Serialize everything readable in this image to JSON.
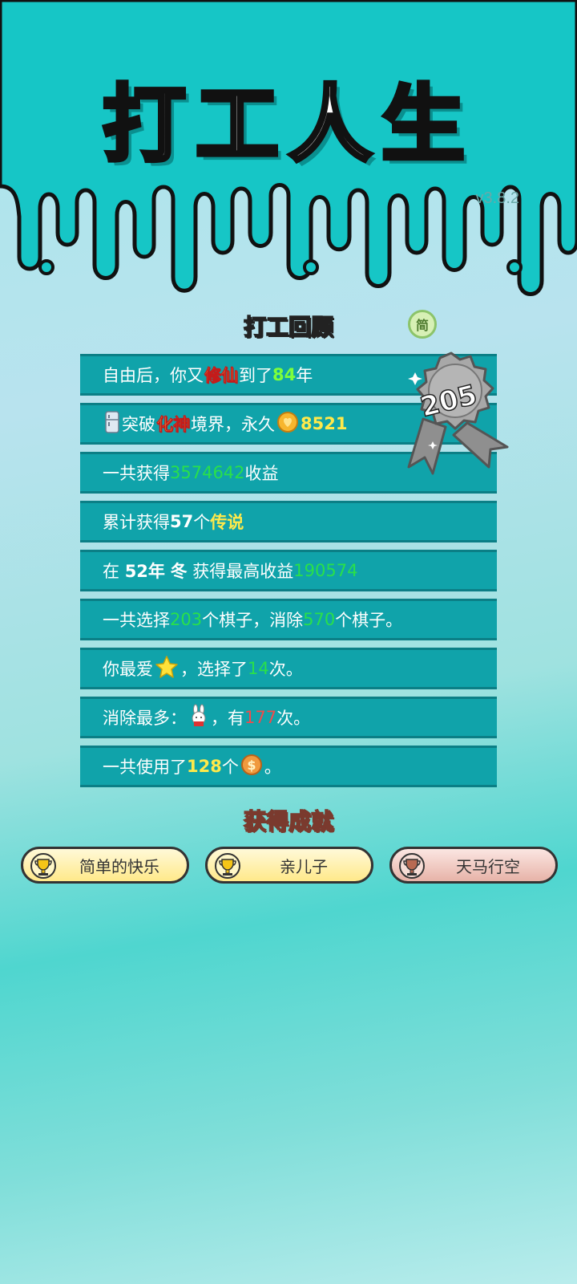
{
  "app": {
    "title": "打工人生",
    "version": "v3.8.2"
  },
  "review": {
    "title": "打工回顾",
    "simple_toggle": "简",
    "badge_number": "205",
    "rows": [
      {
        "parts": [
          "自由后，你又",
          "修仙",
          "到了",
          "84",
          "年"
        ]
      },
      {
        "parts": [
          "突破",
          "化神",
          "境界，永久",
          "8521"
        ]
      },
      {
        "parts": [
          "一共获得",
          "3574642",
          "收益"
        ]
      },
      {
        "parts": [
          "累计获得",
          "57",
          "个",
          "传说"
        ]
      },
      {
        "parts": [
          "在",
          "52年",
          "冬",
          "获得最高收益",
          "190574"
        ]
      },
      {
        "parts": [
          "一共选择",
          "203",
          "个棋子，消除",
          "570",
          "个棋子。"
        ]
      },
      {
        "parts": [
          "你最爱",
          "，选择了",
          "14",
          "次。"
        ]
      },
      {
        "parts": [
          "消除最多：",
          "，有",
          "177",
          "次。"
        ]
      },
      {
        "parts": [
          "一共使用了",
          "128",
          "个",
          "。"
        ]
      }
    ],
    "icons": {
      "realm": "fridge-icon",
      "heart": "heart-coin-icon",
      "favorite": "star-icon",
      "most_removed": "rabbit-icon",
      "currency": "dollar-coin-icon"
    }
  },
  "achievements": {
    "title": "获得成就",
    "items": [
      {
        "label": "简单的快乐",
        "tier": "gold"
      },
      {
        "label": "亲儿子",
        "tier": "gold"
      },
      {
        "label": "天马行空",
        "tier": "bronze"
      }
    ]
  },
  "colors": {
    "header_bg": "#16c6c6",
    "row_bg": "#10a3aa",
    "green_value": "#29e04a",
    "yellow_value": "#ffe94a",
    "red_value": "#f24a4a"
  }
}
